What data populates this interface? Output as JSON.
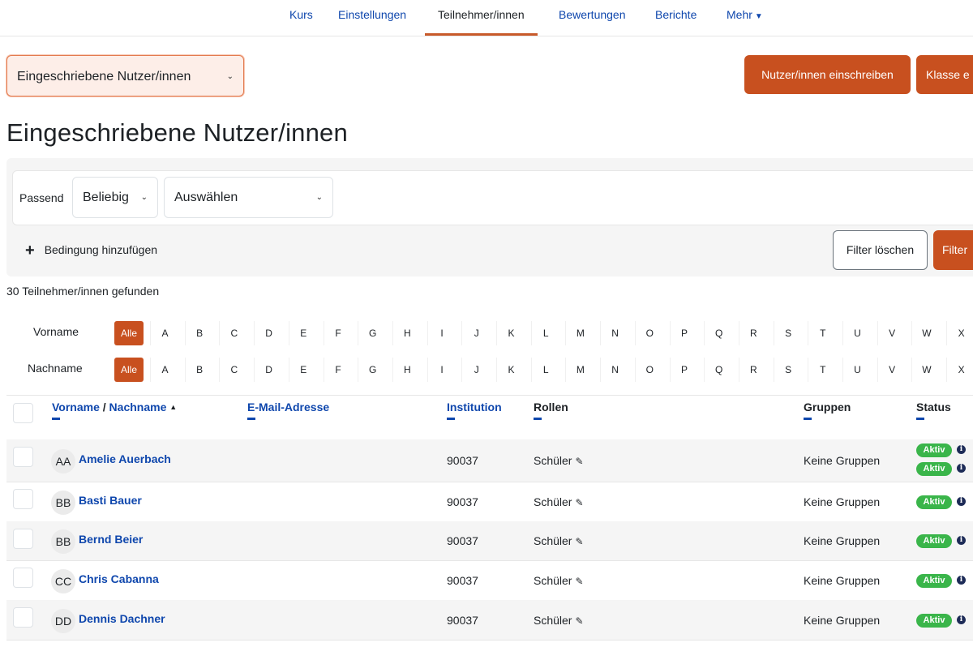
{
  "nav": {
    "tabs": [
      {
        "label": "Kurs"
      },
      {
        "label": "Einstellungen"
      },
      {
        "label": "Teilnehmer/innen"
      },
      {
        "label": "Bewertungen"
      },
      {
        "label": "Berichte"
      },
      {
        "label": "Mehr"
      }
    ],
    "active_tab": "Teilnehmer/innen",
    "more_icon": "chevron-down-icon"
  },
  "page_select": {
    "value": "Eingeschriebene Nutzer/innen"
  },
  "buttons": {
    "enrol": "Nutzer/innen einschreiben",
    "enrol_class": "Klasse e"
  },
  "title": "Eingeschriebene Nutzer/innen",
  "filter": {
    "match_label": "Passend",
    "match_value": "Beliebig",
    "type_value": "Auswählen",
    "add_condition": "Bedingung hinzufügen",
    "clear": "Filter löschen",
    "apply": "Filter"
  },
  "found_text": "30 Teilnehmer/innen gefunden",
  "initials": {
    "firstname_label": "Vorname",
    "lastname_label": "Nachname",
    "all_label": "Alle",
    "letters": [
      "A",
      "B",
      "C",
      "D",
      "E",
      "F",
      "G",
      "H",
      "I",
      "J",
      "K",
      "L",
      "M",
      "N",
      "O",
      "P",
      "Q",
      "R",
      "S",
      "T",
      "U",
      "V",
      "W",
      "X"
    ]
  },
  "table": {
    "headers": {
      "firstname": "Vorname",
      "separator": "/",
      "lastname": "Nachname",
      "sort_indicator": "▲",
      "email": "E-Mail-Adresse",
      "institution": "Institution",
      "roles": "Rollen",
      "groups": "Gruppen",
      "status": "Status"
    },
    "rows": [
      {
        "initials": "AA",
        "name": "Amelie Auerbach",
        "institution": "90037",
        "role": "Schüler",
        "groups": "Keine Gruppen",
        "status": [
          "Aktiv",
          "Aktiv"
        ]
      },
      {
        "initials": "BB",
        "name": "Basti Bauer",
        "institution": "90037",
        "role": "Schüler",
        "groups": "Keine Gruppen",
        "status": [
          "Aktiv"
        ]
      },
      {
        "initials": "BB",
        "name": "Bernd Beier",
        "institution": "90037",
        "role": "Schüler",
        "groups": "Keine Gruppen",
        "status": [
          "Aktiv"
        ]
      },
      {
        "initials": "CC",
        "name": "Chris Cabanna",
        "institution": "90037",
        "role": "Schüler",
        "groups": "Keine Gruppen",
        "status": [
          "Aktiv"
        ]
      },
      {
        "initials": "DD",
        "name": "Dennis Dachner",
        "institution": "90037",
        "role": "Schüler",
        "groups": "Keine Gruppen",
        "status": [
          "Aktiv"
        ]
      }
    ]
  },
  "colors": {
    "accent": "#c8501f",
    "link": "#0f47ad",
    "status_active": "#3ab54a"
  }
}
